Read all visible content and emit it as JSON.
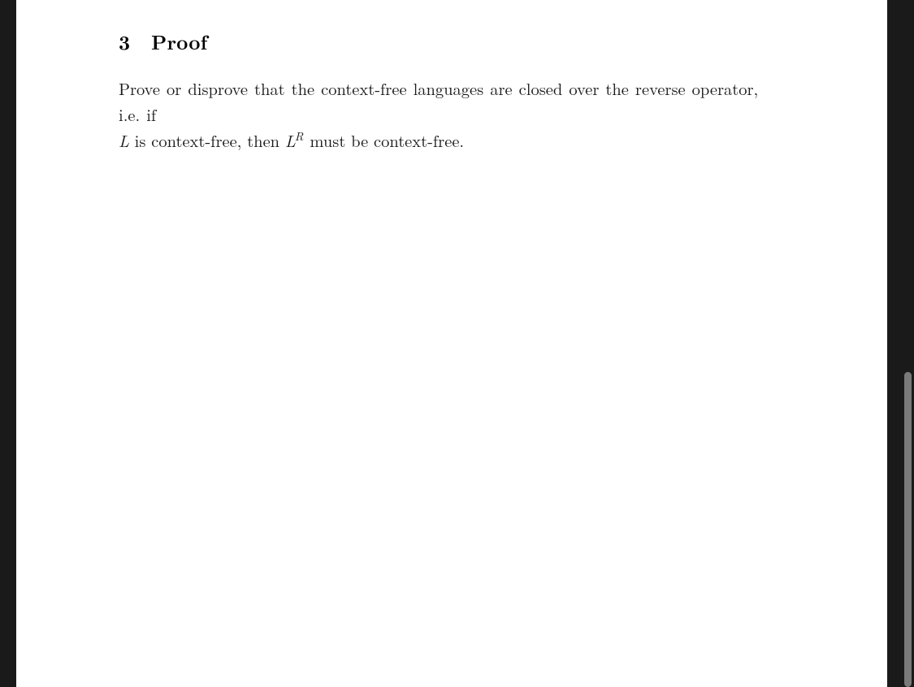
{
  "section": {
    "number": "3",
    "title": "Proof"
  },
  "paragraph": {
    "line1_prefix": "Prove or disprove that the context-free languages are closed over the reverse operator, i.e.  if",
    "line2_prefix_var": "L",
    "line2_mid": " is context-free, then ",
    "line2_var2_base": "L",
    "line2_var2_sup": "R",
    "line2_suffix": " must be context-free."
  }
}
